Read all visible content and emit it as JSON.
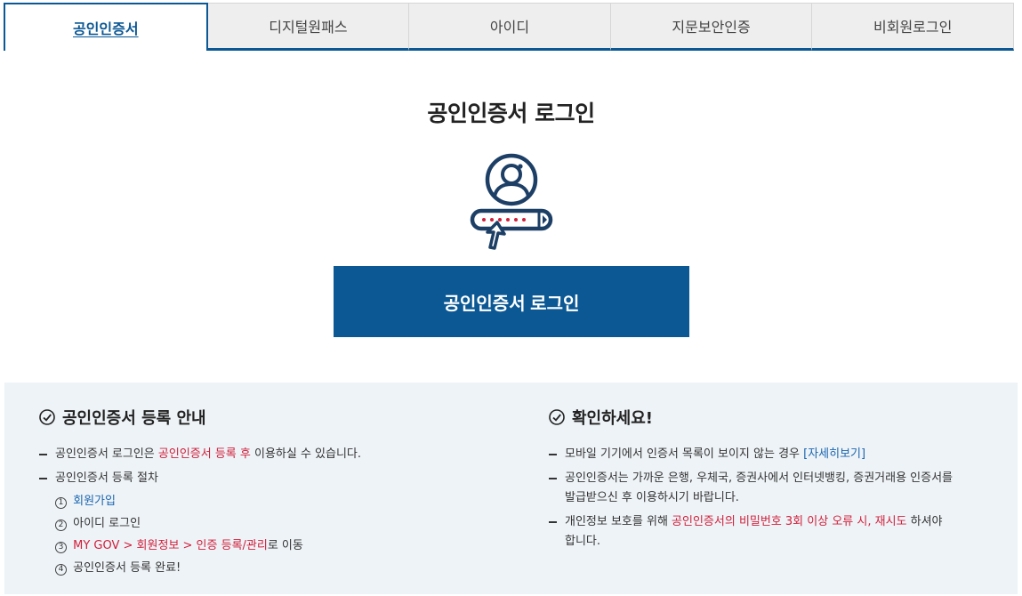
{
  "tabs": [
    {
      "label": "공인인증서",
      "active": true
    },
    {
      "label": "디지털원패스",
      "active": false
    },
    {
      "label": "아이디",
      "active": false
    },
    {
      "label": "지문보안인증",
      "active": false
    },
    {
      "label": "비회원로그인",
      "active": false
    }
  ],
  "main": {
    "title": "공인인증서 로그인",
    "login_button": "공인인증서 로그인",
    "icon": "certificate-user-password-icon"
  },
  "info_left": {
    "title": "공인인증서 등록 안내",
    "item1": {
      "pre": "공인인증서 로그인은 ",
      "highlight": "공인인증서 등록 후",
      "post": " 이용하실 수 있습니다."
    },
    "item2": {
      "text": "공인인증서 등록 절차"
    },
    "steps": {
      "s1": {
        "num": "1",
        "link": "회원가입"
      },
      "s2": {
        "num": "2",
        "text": "아이디 로그인"
      },
      "s3": {
        "num": "3",
        "highlight": "MY GOV > 회원정보 > 인증 등록/관리",
        "post": "로 이동"
      },
      "s4": {
        "num": "4",
        "text": "공인인증서 등록 완료!"
      }
    }
  },
  "info_right": {
    "title": "확인하세요!",
    "item1": {
      "pre": "모바일 기기에서 인증서 목록이 보이지 않는 경우 ",
      "link": "[자세히보기]"
    },
    "item2": {
      "line1": "공인인증서는 가까운 은행, 우체국, 증권사에서 인터넷뱅킹, 증권거래용 인증서를",
      "line2": "발급받으신 후 이용하시기 바랍니다."
    },
    "item3": {
      "pre": "개인정보 보호를 위해 ",
      "highlight": "공인인증서의 비밀번호 3회 이상 오류 시, 재시도",
      "post": " 하셔야",
      "line2": "합니다."
    }
  },
  "colors": {
    "primary": "#0b5894",
    "highlight": "#d11f3a",
    "link": "#1a66b0",
    "panel": "#eef3f7"
  }
}
